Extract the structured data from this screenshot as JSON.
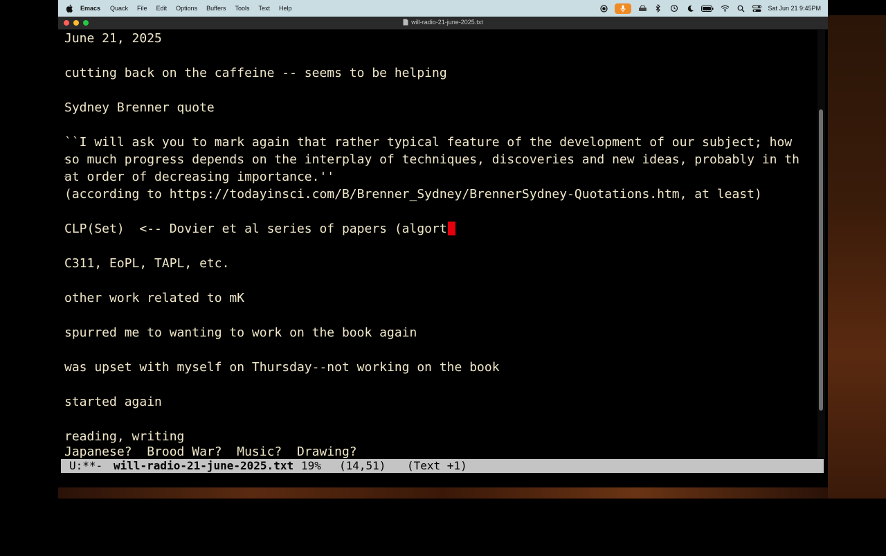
{
  "menubar": {
    "app_name": "Emacs",
    "items": [
      "Quack",
      "File",
      "Edit",
      "Options",
      "Buffers",
      "Tools",
      "Text",
      "Help"
    ],
    "status_icons": [
      "record-icon",
      "microphone-icon",
      "drive-icon",
      "bluetooth-icon",
      "time-machine-icon",
      "moon-icon",
      "battery-icon",
      "wifi-icon",
      "search-icon",
      "control-center-icon"
    ],
    "clock": "Sat Jun 21  9:45PM"
  },
  "window": {
    "title": "will-radio-21-june-2025.txt",
    "traffic_lights": {
      "close": "#fe5f57",
      "minimize": "#febc2e",
      "zoom": "#28c840"
    }
  },
  "editor": {
    "text_color": "#f1e8c9",
    "background": "#000000",
    "cursor_color": "#e5000e",
    "lines": [
      "June 21, 2025",
      "",
      "cutting back on the caffeine -- seems to be helping",
      "",
      "Sydney Brenner quote",
      "",
      "``I will ask you to mark again that rather typical feature of the development of our subject; how ",
      "so much progress depends on the interplay of techniques, discoveries and new ideas, probably in th",
      "at order of decreasing importance.''",
      "(according to https://todayinsci.com/B/Brenner_Sydney/BrennerSydney-Quotations.htm, at least)",
      "",
      "CLP(Set)  <-- Dovier et al series of papers (algort",
      "",
      "C311, EoPL, TAPL, etc.",
      "",
      "other work related to mK",
      "",
      "spurred me to wanting to work on the book again",
      "",
      "was upset with myself on Thursday--not working on the book",
      "",
      "started again",
      "",
      "reading, writing",
      "Japanese?  Brood War?  Music?  Drawing?"
    ]
  },
  "modeline": {
    "state": "U:**-",
    "buffer_name": "will-radio-21-june-2025.txt",
    "percent": "19%",
    "position": "(14,51)",
    "mode": "(Text +1)"
  }
}
